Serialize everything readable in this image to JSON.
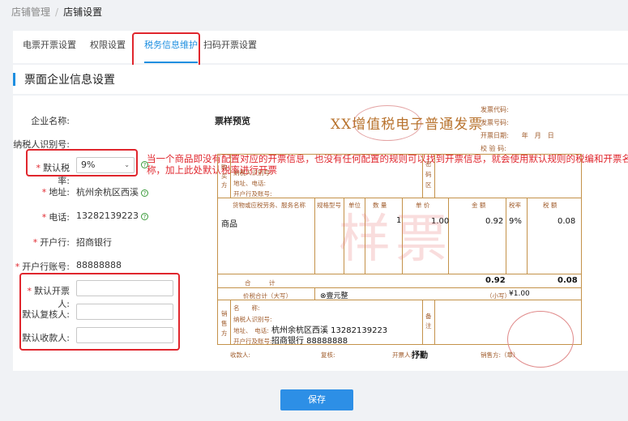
{
  "breadcrumb": {
    "parent": "店铺管理",
    "current": "店铺设置"
  },
  "tabs": [
    "电票开票设置",
    "权限设置",
    "税务信息维护",
    "扫码开票设置"
  ],
  "section_title": "票面企业信息设置",
  "form": {
    "company_label": "企业名称:",
    "taxpayer_label": "纳税人识别号:",
    "default_rate_label": "默认税率:",
    "default_rate_value": "9%",
    "address_label": "地址:",
    "address_value": "杭州余杭区西溪",
    "phone_label": "电话:",
    "phone_value": "13282139223",
    "bank_label": "开户行:",
    "bank_value": "招商银行",
    "account_label": "开户行账号:",
    "account_value": "88888888",
    "drawer_label": "默认开票人:",
    "reviewer_label": "默认复核人:",
    "payee_label": "默认收款人:"
  },
  "note": "当一个商品即没有配置对应的开票信息，也没有任何配置的规则可以找到开票信息，就会使用默认规则的税编和开票名称，加上此处默认税率进行开票",
  "invoice": {
    "preview_label": "票样预览",
    "title": "XX增值税电子普通发票",
    "meta": [
      "发票代码:",
      "发票号码:",
      "开票日期:　　年　月　日",
      "校 验 码:"
    ],
    "buyer_side": "购买方",
    "buyer_fields": [
      "纳税人识别号:",
      "地址、电话:",
      "开户行及账号:"
    ],
    "pwd_area": "密码区",
    "col_headers": [
      "货物或应税劳务、服务名称",
      "规格型号",
      "单位",
      "数 量",
      "单 价",
      "金 额",
      "税率",
      "税 额"
    ],
    "item_name": "商品",
    "item_qty": "1",
    "item_price": "1.00",
    "item_amount": "0.92",
    "item_rate": "9%",
    "item_tax": "0.08",
    "total_label": "合　　　计",
    "total_amount": "0.92",
    "total_tax": "0.08",
    "sum_label": "价税合计（大写）",
    "sum_upper": "⊗壹元整",
    "sum_lower_label": "（小写）",
    "sum_lower": "¥1.00",
    "watermark": "样票",
    "seller_side": "销售方",
    "seller_fields": [
      "名　　称:",
      "纳税人识别号:",
      "地址、　电话:",
      "开户行及账号:"
    ],
    "seller_addr": "杭州余杭区西溪 13282139223",
    "seller_bank": "招商银行 88888888",
    "remark": "备注",
    "footer_payee": "收款人:",
    "footer_review": "复核:",
    "footer_drawer": "开票人:",
    "footer_drawer_name": "抒勤",
    "footer_seller": "销售方:（章）"
  },
  "save_label": "保存"
}
